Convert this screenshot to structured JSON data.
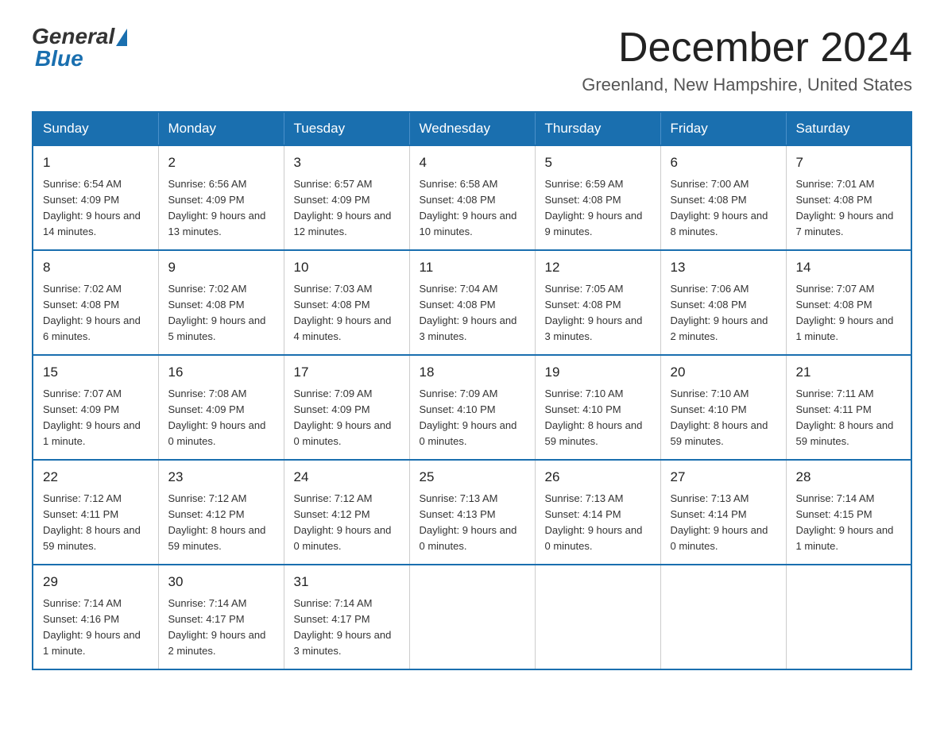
{
  "logo": {
    "general": "General",
    "blue": "Blue"
  },
  "title": "December 2024",
  "location": "Greenland, New Hampshire, United States",
  "weekdays": [
    "Sunday",
    "Monday",
    "Tuesday",
    "Wednesday",
    "Thursday",
    "Friday",
    "Saturday"
  ],
  "weeks": [
    [
      {
        "day": "1",
        "sunrise": "6:54 AM",
        "sunset": "4:09 PM",
        "daylight": "9 hours and 14 minutes."
      },
      {
        "day": "2",
        "sunrise": "6:56 AM",
        "sunset": "4:09 PM",
        "daylight": "9 hours and 13 minutes."
      },
      {
        "day": "3",
        "sunrise": "6:57 AM",
        "sunset": "4:09 PM",
        "daylight": "9 hours and 12 minutes."
      },
      {
        "day": "4",
        "sunrise": "6:58 AM",
        "sunset": "4:08 PM",
        "daylight": "9 hours and 10 minutes."
      },
      {
        "day": "5",
        "sunrise": "6:59 AM",
        "sunset": "4:08 PM",
        "daylight": "9 hours and 9 minutes."
      },
      {
        "day": "6",
        "sunrise": "7:00 AM",
        "sunset": "4:08 PM",
        "daylight": "9 hours and 8 minutes."
      },
      {
        "day": "7",
        "sunrise": "7:01 AM",
        "sunset": "4:08 PM",
        "daylight": "9 hours and 7 minutes."
      }
    ],
    [
      {
        "day": "8",
        "sunrise": "7:02 AM",
        "sunset": "4:08 PM",
        "daylight": "9 hours and 6 minutes."
      },
      {
        "day": "9",
        "sunrise": "7:02 AM",
        "sunset": "4:08 PM",
        "daylight": "9 hours and 5 minutes."
      },
      {
        "day": "10",
        "sunrise": "7:03 AM",
        "sunset": "4:08 PM",
        "daylight": "9 hours and 4 minutes."
      },
      {
        "day": "11",
        "sunrise": "7:04 AM",
        "sunset": "4:08 PM",
        "daylight": "9 hours and 3 minutes."
      },
      {
        "day": "12",
        "sunrise": "7:05 AM",
        "sunset": "4:08 PM",
        "daylight": "9 hours and 3 minutes."
      },
      {
        "day": "13",
        "sunrise": "7:06 AM",
        "sunset": "4:08 PM",
        "daylight": "9 hours and 2 minutes."
      },
      {
        "day": "14",
        "sunrise": "7:07 AM",
        "sunset": "4:08 PM",
        "daylight": "9 hours and 1 minute."
      }
    ],
    [
      {
        "day": "15",
        "sunrise": "7:07 AM",
        "sunset": "4:09 PM",
        "daylight": "9 hours and 1 minute."
      },
      {
        "day": "16",
        "sunrise": "7:08 AM",
        "sunset": "4:09 PM",
        "daylight": "9 hours and 0 minutes."
      },
      {
        "day": "17",
        "sunrise": "7:09 AM",
        "sunset": "4:09 PM",
        "daylight": "9 hours and 0 minutes."
      },
      {
        "day": "18",
        "sunrise": "7:09 AM",
        "sunset": "4:10 PM",
        "daylight": "9 hours and 0 minutes."
      },
      {
        "day": "19",
        "sunrise": "7:10 AM",
        "sunset": "4:10 PM",
        "daylight": "8 hours and 59 minutes."
      },
      {
        "day": "20",
        "sunrise": "7:10 AM",
        "sunset": "4:10 PM",
        "daylight": "8 hours and 59 minutes."
      },
      {
        "day": "21",
        "sunrise": "7:11 AM",
        "sunset": "4:11 PM",
        "daylight": "8 hours and 59 minutes."
      }
    ],
    [
      {
        "day": "22",
        "sunrise": "7:12 AM",
        "sunset": "4:11 PM",
        "daylight": "8 hours and 59 minutes."
      },
      {
        "day": "23",
        "sunrise": "7:12 AM",
        "sunset": "4:12 PM",
        "daylight": "8 hours and 59 minutes."
      },
      {
        "day": "24",
        "sunrise": "7:12 AM",
        "sunset": "4:12 PM",
        "daylight": "9 hours and 0 minutes."
      },
      {
        "day": "25",
        "sunrise": "7:13 AM",
        "sunset": "4:13 PM",
        "daylight": "9 hours and 0 minutes."
      },
      {
        "day": "26",
        "sunrise": "7:13 AM",
        "sunset": "4:14 PM",
        "daylight": "9 hours and 0 minutes."
      },
      {
        "day": "27",
        "sunrise": "7:13 AM",
        "sunset": "4:14 PM",
        "daylight": "9 hours and 0 minutes."
      },
      {
        "day": "28",
        "sunrise": "7:14 AM",
        "sunset": "4:15 PM",
        "daylight": "9 hours and 1 minute."
      }
    ],
    [
      {
        "day": "29",
        "sunrise": "7:14 AM",
        "sunset": "4:16 PM",
        "daylight": "9 hours and 1 minute."
      },
      {
        "day": "30",
        "sunrise": "7:14 AM",
        "sunset": "4:17 PM",
        "daylight": "9 hours and 2 minutes."
      },
      {
        "day": "31",
        "sunrise": "7:14 AM",
        "sunset": "4:17 PM",
        "daylight": "9 hours and 3 minutes."
      },
      null,
      null,
      null,
      null
    ]
  ]
}
